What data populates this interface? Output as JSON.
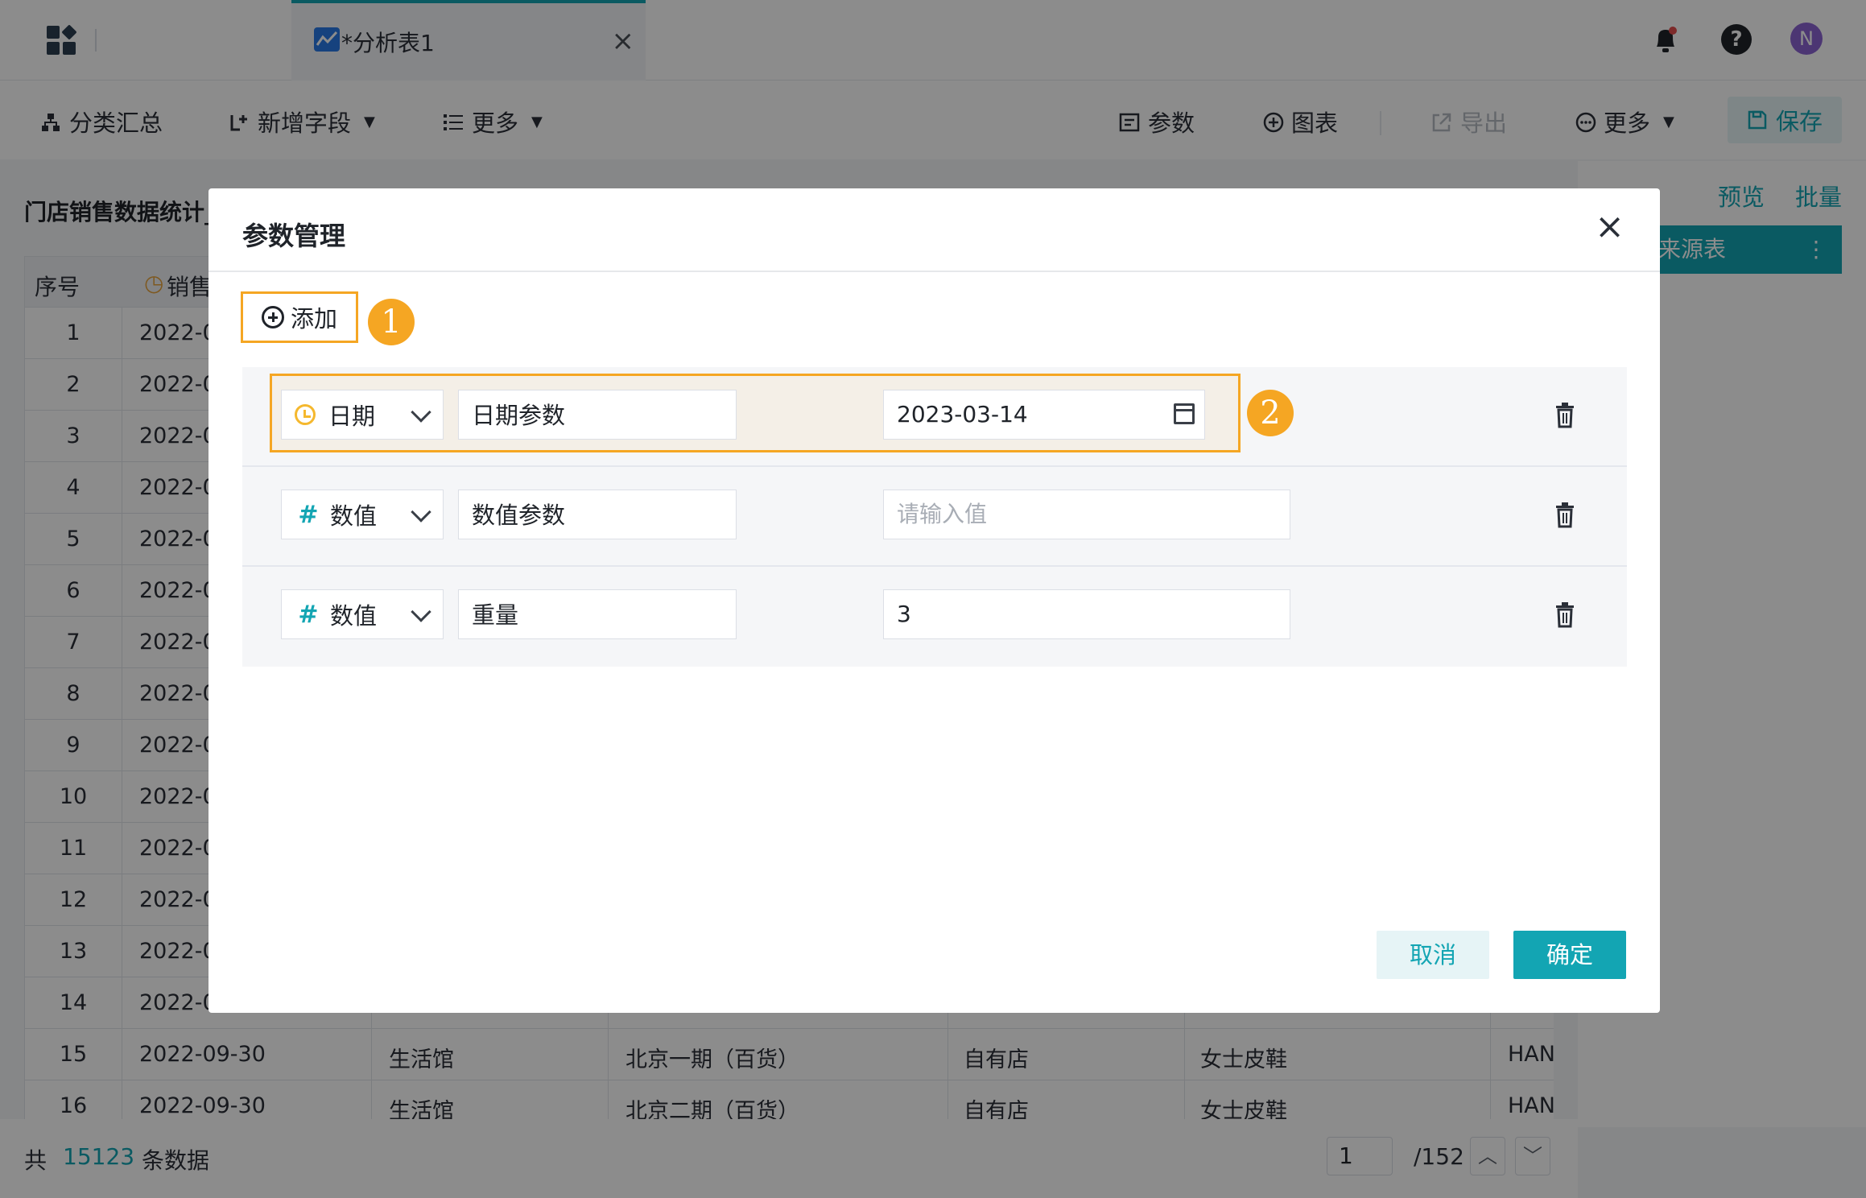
{
  "tab": {
    "title": "*分析表1",
    "close": "×"
  },
  "topbar": {
    "avatar_letter": "N",
    "help": "?"
  },
  "toolbar": {
    "group_summary": "分类汇总",
    "add_field": "新增字段",
    "more_left": "更多",
    "params": "参数",
    "chart": "图表",
    "export": "导出",
    "more_right": "更多",
    "save": "保存"
  },
  "sheet": {
    "title": "门店销售数据统计_",
    "preview": "预览",
    "batch": "批量",
    "source_table": "来源表",
    "columns": [
      "序号",
      "销售"
    ],
    "rows": [
      {
        "n": "1",
        "date": "2022-0"
      },
      {
        "n": "2",
        "date": "2022-0"
      },
      {
        "n": "3",
        "date": "2022-0"
      },
      {
        "n": "4",
        "date": "2022-0"
      },
      {
        "n": "5",
        "date": "2022-0"
      },
      {
        "n": "6",
        "date": "2022-0"
      },
      {
        "n": "7",
        "date": "2022-0"
      },
      {
        "n": "8",
        "date": "2022-0"
      },
      {
        "n": "9",
        "date": "2022-0"
      },
      {
        "n": "10",
        "date": "2022-0"
      },
      {
        "n": "11",
        "date": "2022-0"
      },
      {
        "n": "12",
        "date": "2022-0"
      },
      {
        "n": "13",
        "date": "2022-0"
      },
      {
        "n": "14",
        "date": "2022-0"
      },
      {
        "n": "15",
        "date": "2022-09-30",
        "c3": "生活馆",
        "c4": "北京一期（百货）",
        "c5": "自有店",
        "c6": "女士皮鞋",
        "c7": "HAN"
      },
      {
        "n": "16",
        "date": "2022-09-30",
        "c3": "生活馆",
        "c4": "北京二期（百货）",
        "c5": "自有店",
        "c6": "女士皮鞋",
        "c7": "HAN"
      }
    ]
  },
  "footer": {
    "prefix": "共",
    "count": "15123",
    "suffix": "条数据",
    "page": "1",
    "total_pages": "/152"
  },
  "modal": {
    "title": "参数管理",
    "close": "×",
    "add_label": "添加",
    "badge1": "1",
    "badge2": "2",
    "params": [
      {
        "type": "日期",
        "name": "日期参数",
        "value": "2023-03-14",
        "placeholder": ""
      },
      {
        "type": "数值",
        "name": "数值参数",
        "value": "",
        "placeholder": "请输入值"
      },
      {
        "type": "数值",
        "name": "重量",
        "value": "3",
        "placeholder": ""
      }
    ],
    "cancel": "取消",
    "confirm": "确定"
  },
  "colors": {
    "accent": "#13a5b3",
    "highlight": "#f5a623"
  }
}
